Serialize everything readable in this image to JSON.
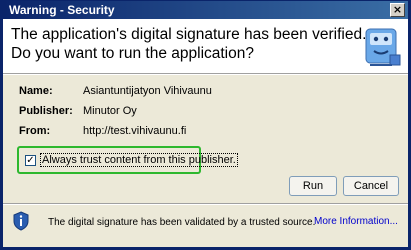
{
  "window": {
    "title": "Warning - Security",
    "close_glyph": "×"
  },
  "header": {
    "line1": "The application's digital signature has been verified.",
    "line2": "Do you want to run the application?",
    "icon": "java-coffee-cup-icon"
  },
  "fields": [
    {
      "label": "Name:",
      "value": "Asiantuntijatyon Vihivaunu"
    },
    {
      "label": "Publisher:",
      "value": "Minutor Oy"
    },
    {
      "label": "From:",
      "value": "http://test.vihivaunu.fi"
    }
  ],
  "trust": {
    "checked": true,
    "check_glyph": "✓",
    "label": "Always trust content from this publisher."
  },
  "buttons": {
    "run": "Run",
    "cancel": "Cancel"
  },
  "footer": {
    "icon": "shield-icon",
    "text": "The digital signature has been validated by a trusted source.",
    "more_info": "More Information..."
  },
  "colors": {
    "titlebar": "#0a246a",
    "highlight_border": "#2eb82e",
    "link": "#0000cc"
  }
}
